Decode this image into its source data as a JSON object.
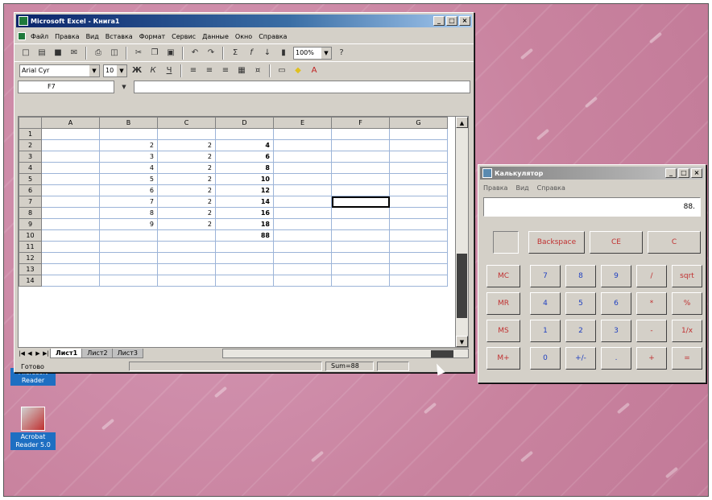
{
  "excel": {
    "title": "Microsoft Excel - Книга1",
    "menu": [
      "Файл",
      "Правка",
      "Вид",
      "Вставка",
      "Формат",
      "Сервис",
      "Данные",
      "Окно",
      "Справка"
    ],
    "font_name": "Arial Cyr",
    "font_size": "10",
    "zoom": "100%",
    "name_box": "F7",
    "columns": [
      "A",
      "B",
      "C",
      "D",
      "E",
      "F",
      "G"
    ],
    "rows": [
      {
        "n": "1",
        "b": "",
        "c": "",
        "d": ""
      },
      {
        "n": "2",
        "b": "2",
        "c": "2",
        "d": "4"
      },
      {
        "n": "3",
        "b": "3",
        "c": "2",
        "d": "6"
      },
      {
        "n": "4",
        "b": "4",
        "c": "2",
        "d": "8"
      },
      {
        "n": "5",
        "b": "5",
        "c": "2",
        "d": "10"
      },
      {
        "n": "6",
        "b": "6",
        "c": "2",
        "d": "12"
      },
      {
        "n": "7",
        "b": "7",
        "c": "2",
        "d": "14"
      },
      {
        "n": "8",
        "b": "8",
        "c": "2",
        "d": "16"
      },
      {
        "n": "9",
        "b": "9",
        "c": "2",
        "d": "18"
      },
      {
        "n": "10",
        "b": "",
        "c": "",
        "d": "88"
      },
      {
        "n": "11",
        "b": "",
        "c": "",
        "d": ""
      },
      {
        "n": "12",
        "b": "",
        "c": "",
        "d": ""
      },
      {
        "n": "13",
        "b": "",
        "c": "",
        "d": ""
      },
      {
        "n": "14",
        "b": "",
        "c": "",
        "d": ""
      }
    ],
    "sheet_tabs": [
      "Лист1",
      "Лист2",
      "Лист3"
    ],
    "status_ready": "Готово",
    "status_sum": "Sum=88"
  },
  "calculator": {
    "title": "Калькулятор",
    "menu": [
      "Правка",
      "Вид",
      "Справка"
    ],
    "display": "88.",
    "backspace_label": "Backspace",
    "ce_label": "CE",
    "c_label": "C",
    "memory_buttons": [
      "MC",
      "MR",
      "MS",
      "M+"
    ],
    "digit_rows": [
      [
        "7",
        "8",
        "9",
        "/",
        "sqrt"
      ],
      [
        "4",
        "5",
        "6",
        "*",
        "%"
      ],
      [
        "1",
        "2",
        "3",
        "-",
        "1/x"
      ],
      [
        "0",
        "+/-",
        ".",
        "+",
        "="
      ]
    ]
  },
  "desktop": {
    "icons": [
      {
        "label": "Microsoft Reader"
      },
      {
        "label": "Acrobat Reader 5.0"
      }
    ]
  }
}
